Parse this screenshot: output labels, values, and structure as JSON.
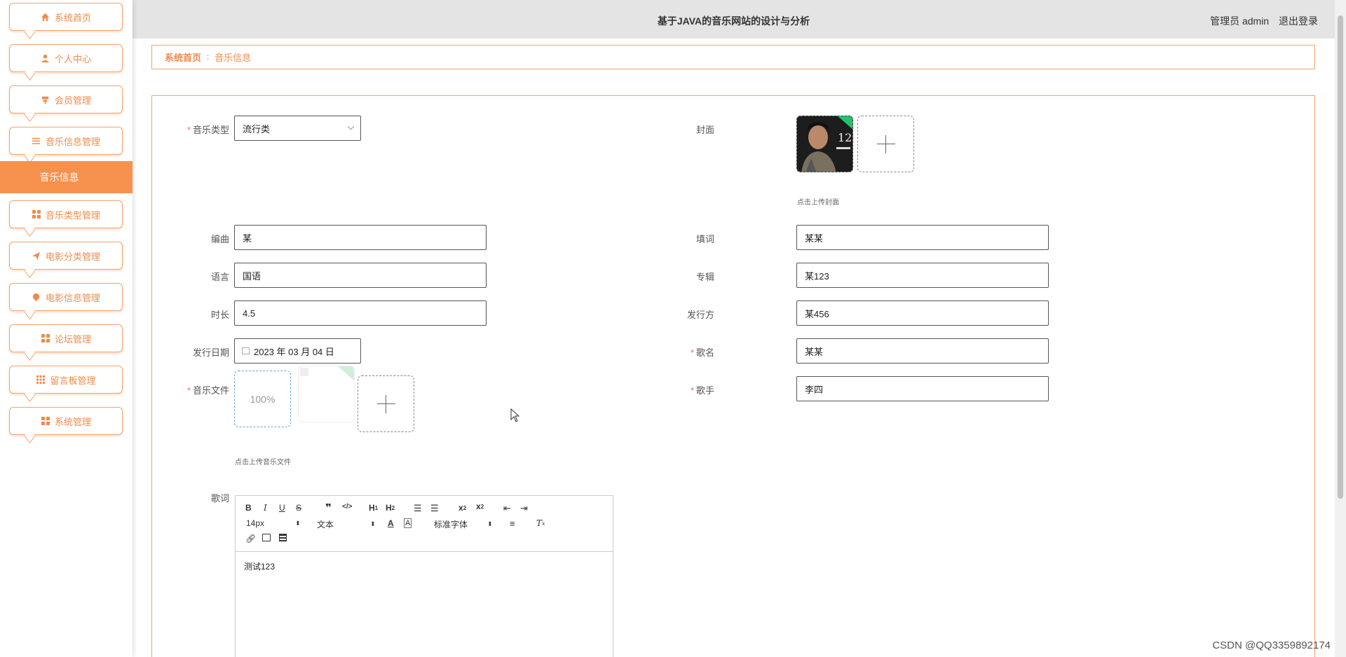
{
  "header": {
    "title": "基于JAVA的音乐网站的设计与分析",
    "user": "管理员 admin",
    "logout": "退出登录"
  },
  "sidebar": {
    "items": [
      {
        "label": "系统首页",
        "icon": "home-icon"
      },
      {
        "label": "个人中心",
        "icon": "user-icon"
      },
      {
        "label": "会员管理",
        "icon": "member-icon"
      },
      {
        "label": "音乐信息管理",
        "icon": "list-icon"
      },
      {
        "label": "音乐类型管理",
        "icon": "grid-icon"
      },
      {
        "label": "电影分类管理",
        "icon": "send-icon"
      },
      {
        "label": "电影信息管理",
        "icon": "pin-icon"
      },
      {
        "label": "论坛管理",
        "icon": "grid-icon"
      },
      {
        "label": "留言板管理",
        "icon": "grid-icon"
      },
      {
        "label": "系统管理",
        "icon": "grid-icon"
      }
    ],
    "active_sub": "音乐信息"
  },
  "breadcrumb": {
    "home": "系统首页",
    "separator": "∶",
    "current": "音乐信息"
  },
  "form": {
    "music_type": {
      "label": "音乐类型",
      "value": "流行类"
    },
    "cover": {
      "label": "封面",
      "hint": "点击上传封面"
    },
    "composer": {
      "label": "编曲",
      "value": "某"
    },
    "lyricist": {
      "label": "填词",
      "value": "某某"
    },
    "language": {
      "label": "语言",
      "value": "国语"
    },
    "album": {
      "label": "专辑",
      "value": "某123"
    },
    "duration": {
      "label": "时长",
      "value": "4.5"
    },
    "publisher": {
      "label": "发行方",
      "value": "某456"
    },
    "release_date": {
      "label": "发行日期",
      "value": "2023 年 03 月 04 日"
    },
    "song_name": {
      "label": "歌名",
      "value": "某某"
    },
    "music_file": {
      "label": "音乐文件",
      "progress": "100%",
      "hint": "点击上传音乐文件"
    },
    "singer": {
      "label": "歌手",
      "value": "李四"
    },
    "lyrics": {
      "label": "歌词",
      "content": "测试123"
    }
  },
  "editor": {
    "font_size": "14px",
    "text_type": "文本",
    "font_family": "标准字体"
  },
  "watermark": "CSDN @QQ3359892174",
  "colors": {
    "accent": "#f7924e",
    "border": "#f6a26a"
  }
}
